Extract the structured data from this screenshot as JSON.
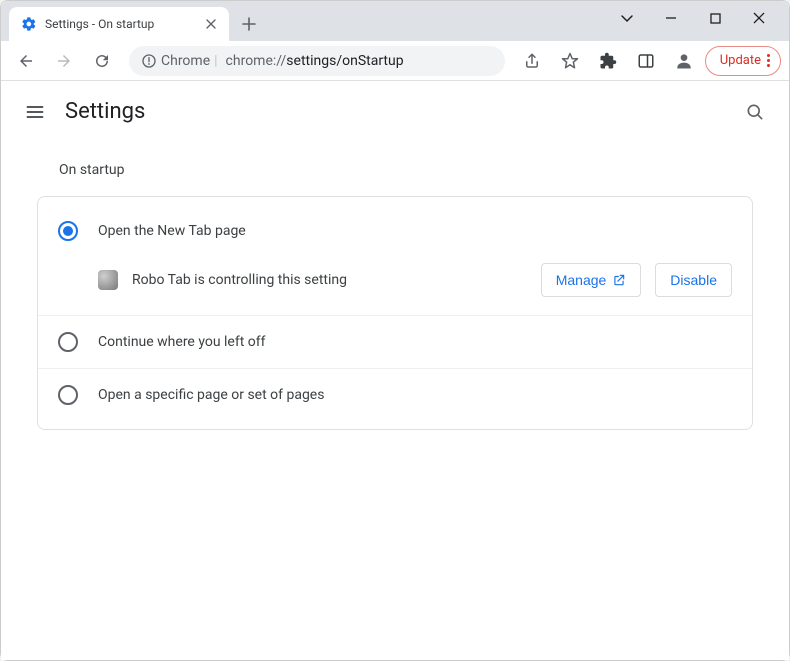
{
  "window": {
    "tab_title": "Settings - On startup"
  },
  "toolbar": {
    "secure_label": "Chrome",
    "url_host": "chrome://",
    "url_path": "settings/onStartup",
    "update_label": "Update"
  },
  "appbar": {
    "title": "Settings"
  },
  "section": {
    "title": "On startup"
  },
  "options": {
    "open_new_tab": "Open the New Tab page",
    "continue": "Continue where you left off",
    "specific": "Open a specific page or set of pages"
  },
  "extension": {
    "message": "Robo Tab is controlling this setting",
    "manage": "Manage",
    "disable": "Disable"
  }
}
